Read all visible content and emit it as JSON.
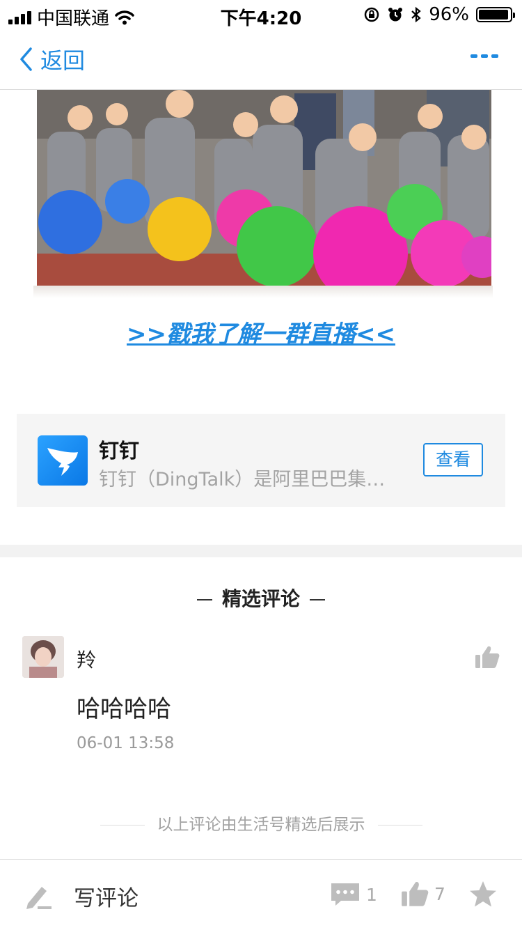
{
  "status_bar": {
    "carrier": "中国联通",
    "time": "下午4:20",
    "battery": "96%"
  },
  "nav": {
    "back_label": "返回"
  },
  "article": {
    "live_link": ">>戳我了解一群直播<<"
  },
  "app_card": {
    "name": "钉钉",
    "description": "钉钉（DingTalk）是阿里巴巴集…",
    "action_label": "查看"
  },
  "comments": {
    "section_title": "精选评论",
    "items": [
      {
        "user": "羚",
        "text": "哈哈哈哈",
        "time": "06-01 13:58"
      }
    ],
    "footer_note": "以上评论由生活号精选后展示"
  },
  "bottom_bar": {
    "write_label": "写评论",
    "comment_count": "1",
    "like_count": "7"
  },
  "icons": {
    "back": "chevron-left-icon",
    "more": "more-dots-icon",
    "write": "pencil-icon",
    "comment": "comment-bubble-icon",
    "like": "thumbs-up-icon",
    "favorite": "star-icon"
  },
  "colors": {
    "accent": "#1f8ae0",
    "muted": "#a3a3a3",
    "icon_gray": "#b5b5b5"
  }
}
